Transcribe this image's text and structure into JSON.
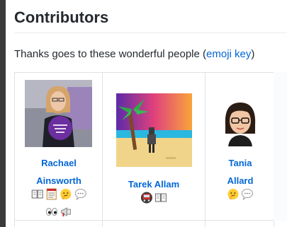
{
  "page": {
    "heading": "Contributors",
    "intro_text": "Thanks goes to these wonderful people (",
    "intro_link": "emoji key"
  },
  "contributors": [
    {
      "name_line1": "Rachael",
      "name_line2": "Ainsworth",
      "contributions": [
        "book-icon",
        "document-icon",
        "thinking-face-icon",
        "speech-balloon-icon",
        "eyes-icon",
        "megaphone-icon"
      ]
    },
    {
      "name_line1": "Tarek Allam",
      "contributions": [
        "bus-icon",
        "book-icon"
      ]
    },
    {
      "name_line1": "Tania",
      "name_line2": "Allard",
      "contributions": [
        "thinking-face-icon",
        "speech-balloon-icon"
      ]
    }
  ],
  "colors": {
    "link": "#0366d6",
    "text": "#24292e",
    "border": "#dfe2e5"
  }
}
